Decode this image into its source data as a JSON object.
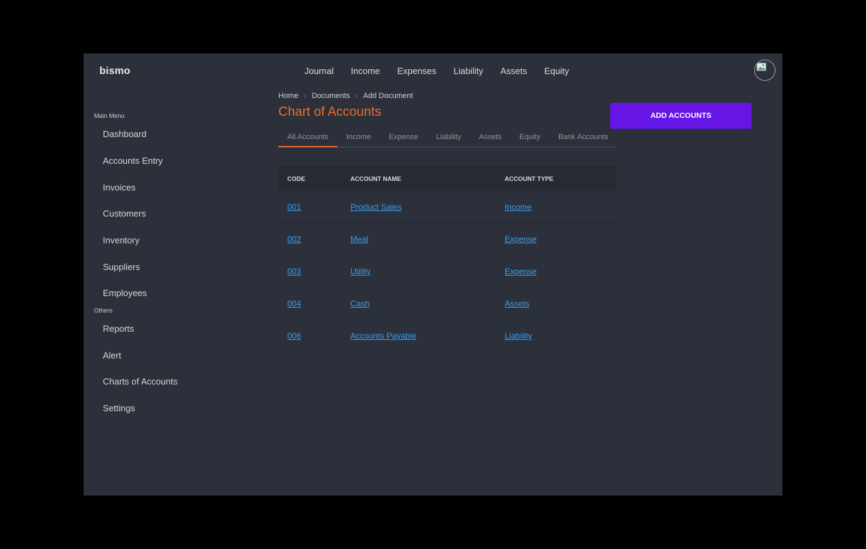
{
  "brand": "bismo",
  "topnav": [
    "Journal",
    "Income",
    "Expenses",
    "Liability",
    "Assets",
    "Equity"
  ],
  "sidebar": {
    "main_heading": "Main Menu",
    "main_items": [
      "Dashboard",
      "Accounts Entry",
      "Invoices",
      "Customers",
      "Inventory",
      "Suppliers",
      "Employees"
    ],
    "others_heading": "Others",
    "other_items": [
      "Reports",
      "Alert",
      "Charts of Accounts",
      "Settings"
    ]
  },
  "breadcrumb": [
    "Home",
    "Documents",
    "Add Document"
  ],
  "page_title": "Chart of Accounts",
  "add_button": "ADD ACCOUNTS",
  "tabs": [
    "All Accounts",
    "Income",
    "Expense",
    "Liability",
    "Assets",
    "Equity",
    "Bank Accounts"
  ],
  "table": {
    "headers": [
      "CODE",
      "ACCOUNT NAME",
      "ACCOUNT TYPE"
    ],
    "rows": [
      [
        "001",
        "Product Sales",
        "Income"
      ],
      [
        "002",
        "Meal",
        "Expense"
      ],
      [
        "003",
        "Utility",
        "Expense"
      ],
      [
        "004",
        "Cash",
        "Assets"
      ],
      [
        "006",
        "Accounts Payable",
        "Liability"
      ]
    ]
  },
  "colors": {
    "background": "#2b303b",
    "accent": "#f26b2a",
    "button": "#6515e6",
    "link": "#3aa0ef"
  },
  "icons": {
    "avatar": "broken-image-icon"
  }
}
